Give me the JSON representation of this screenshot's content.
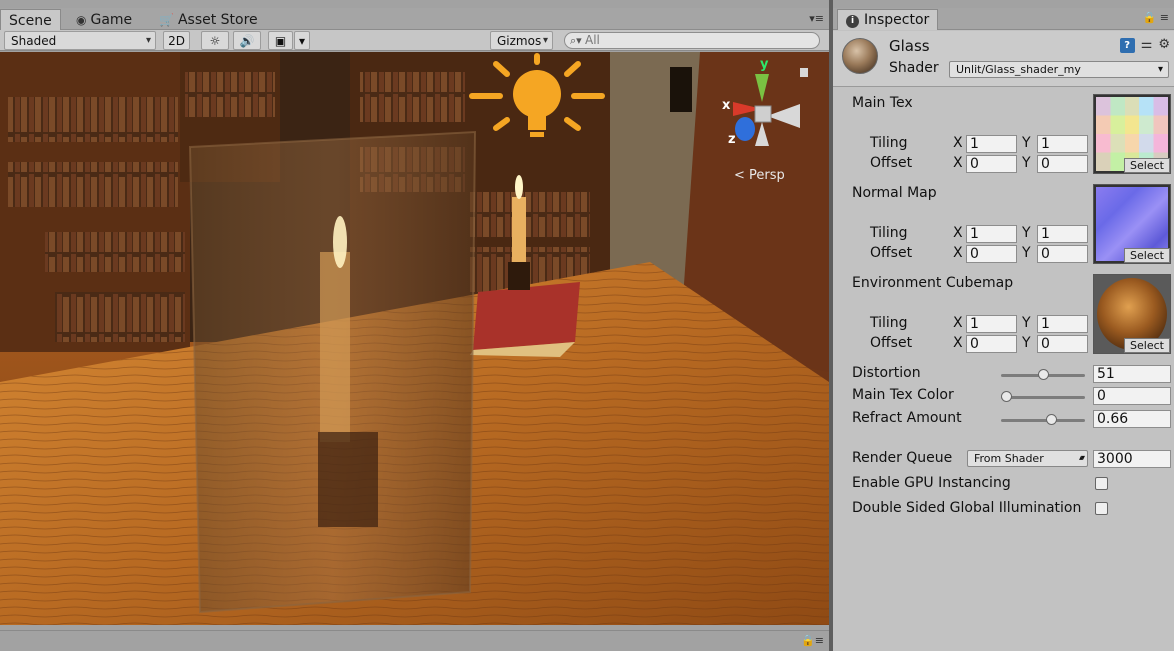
{
  "scene_window": {
    "tabs": [
      {
        "label": "Scene",
        "icon": "scene-icon"
      },
      {
        "label": "Game",
        "icon": "game-icon"
      },
      {
        "label": "Asset Store",
        "icon": "asset-store-icon"
      }
    ],
    "toolbar": {
      "draw_mode": "Shaded",
      "mode_2d": "2D",
      "gizmos": "Gizmos",
      "search_placeholder": "All"
    },
    "viewport": {
      "persp_label": "Persp",
      "axis_labels": {
        "x": "x",
        "y": "y",
        "z": "z"
      }
    }
  },
  "inspector": {
    "tab_label": "Inspector",
    "material": {
      "name": "Glass",
      "shader_label": "Shader",
      "shader_value": "Unlit/Glass_shader_my"
    },
    "textures": [
      {
        "label": "Main Tex",
        "tiling_label": "Tiling",
        "offset_label": "Offset",
        "tiling_x": "1",
        "tiling_y": "1",
        "offset_x": "0",
        "offset_y": "0",
        "select": "Select"
      },
      {
        "label": "Normal Map",
        "tiling_label": "Tiling",
        "offset_label": "Offset",
        "tiling_x": "1",
        "tiling_y": "1",
        "offset_x": "0",
        "offset_y": "0",
        "select": "Select"
      },
      {
        "label": "Environment Cubemap",
        "tiling_label": "Tiling",
        "offset_label": "Offset",
        "tiling_x": "1",
        "tiling_y": "1",
        "offset_x": "0",
        "offset_y": "0",
        "select": "Select"
      }
    ],
    "axis": {
      "x": "X",
      "y": "Y"
    },
    "sliders": [
      {
        "label": "Distortion",
        "value": "51",
        "fraction": 0.5
      },
      {
        "label": "Main Tex Color",
        "value": "0",
        "fraction": 0.0
      },
      {
        "label": "Refract Amount",
        "value": "0.66",
        "fraction": 0.62
      }
    ],
    "render_queue": {
      "label": "Render Queue",
      "mode": "From Shader",
      "value": "3000"
    },
    "checkboxes": [
      {
        "label": "Enable GPU Instancing",
        "checked": false
      },
      {
        "label": "Double Sided Global Illumination",
        "checked": false
      }
    ]
  },
  "colors": {
    "light_icon": "#f5a623",
    "axis_x": "#d93a2a",
    "axis_y": "#7ac142",
    "axis_z": "#2f6fdb"
  }
}
